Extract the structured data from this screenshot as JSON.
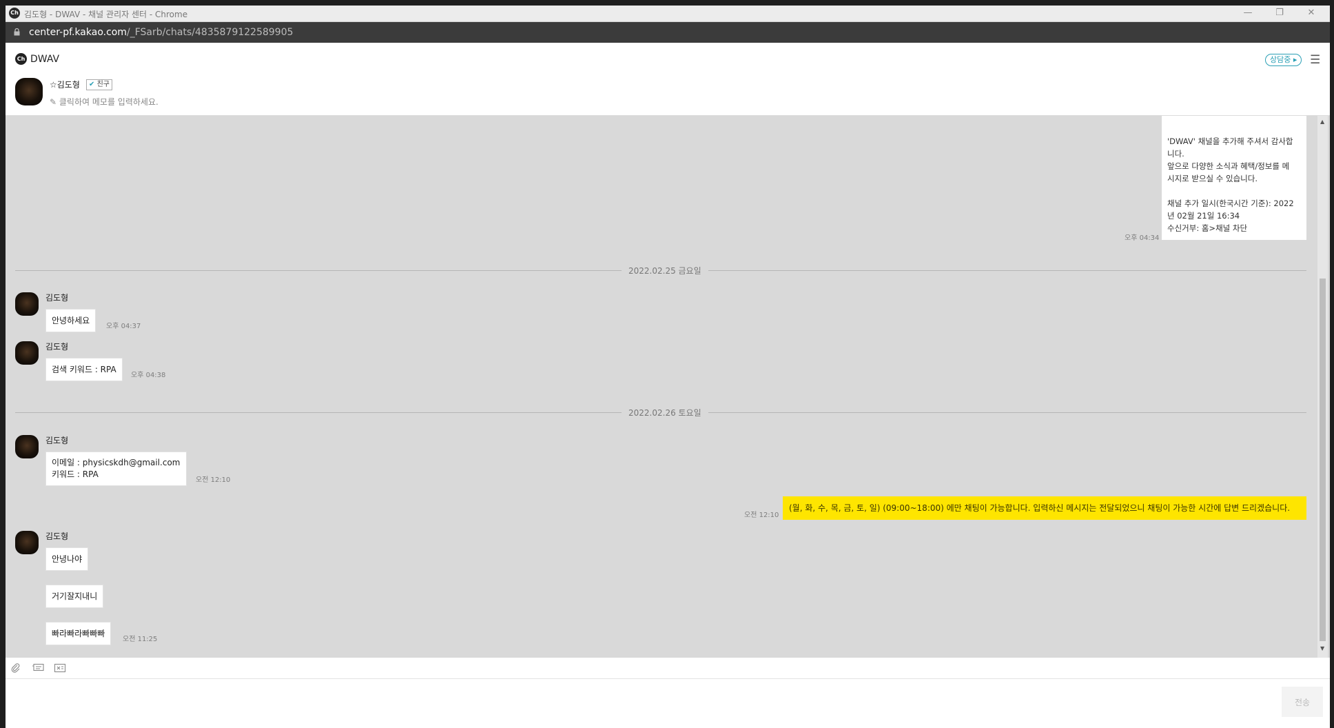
{
  "window": {
    "title": "김도형 - DWAV - 채널 관리자 센터 - Chrome",
    "favicon": "Ch"
  },
  "addressbar": {
    "domain": "center-pf.kakao.com",
    "path": "/_FSarb/chats/4835879122589905"
  },
  "header": {
    "channel_logo": "Ch",
    "channel_name": "DWAV",
    "status_label": "상담중 ▸",
    "user_name": "☆김도형",
    "friend_badge": "친구",
    "memo_placeholder": "클릭하여 메모를 입력하세요."
  },
  "chat": {
    "welcome_message": {
      "text": "'DWAV' 채널을 추가해 주셔서 감사합\n니다.\n앞으로 다양한 소식과 혜택/정보를 메\n시지로 받으실 수 있습니다.\n\n채널 추가 일시(한국시간 기준): 2022\n년 02월 21일 16:34\n수신거부: 홈>채널 차단",
      "time": "오후 04:34"
    },
    "date1": "2022.02.25 금요일",
    "date2": "2022.02.26 토요일",
    "msgs": [
      {
        "sender": "김도형",
        "text": "안녕하세요",
        "time": "오후 04:37"
      },
      {
        "sender": "김도형",
        "text": "검색 키워드 : RPA",
        "time": "오후 04:38"
      },
      {
        "sender": "김도형",
        "line1": "이메일 : physicskdh@gmail.com",
        "line2": "키워드 : RPA",
        "time": "오전 12:10"
      },
      {
        "sender": "김도형",
        "text1": "안녕나야",
        "text2": "거기잘지내니",
        "text3": "빠라빠라빠빠빠",
        "time": "오전 11:25"
      }
    ],
    "auto_reply": {
      "text": "(월, 화, 수, 목, 금, 토, 일) (09:00~18:00) 에만 채팅이 가능합니다. 입력하신 메시지는 전달되었으니 채팅이 가능한 시간에 답변 드리겠습니다.",
      "time": "오전 12:10"
    }
  },
  "input": {
    "send_label": "전송"
  },
  "colors": {
    "chat_bg": "#d9d9d9",
    "auto_reply_bg": "#fee500",
    "accent": "#2a9fb5"
  }
}
